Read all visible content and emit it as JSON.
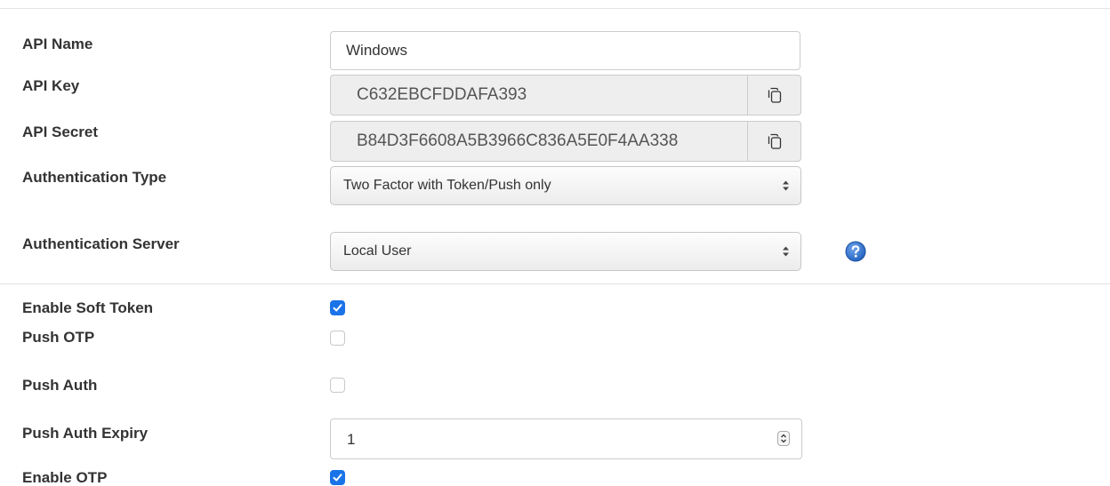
{
  "form": {
    "api_name": {
      "label": "API Name",
      "value": "Windows"
    },
    "api_key": {
      "label": "API Key",
      "value": "C632EBCFDDAFA393",
      "copy_icon": "copy-icon"
    },
    "api_secret": {
      "label": "API Secret",
      "value": "B84D3F6608A5B3966C836A5E0F4AA338",
      "copy_icon": "copy-icon"
    },
    "authentication_type": {
      "label": "Authentication Type",
      "selected": "Two Factor with Token/Push only"
    },
    "authentication_server": {
      "label": "Authentication Server",
      "selected": "Local User",
      "help_icon": "help-icon"
    },
    "enable_soft_token": {
      "label": "Enable Soft Token",
      "checked": true
    },
    "push_otp": {
      "label": "Push OTP",
      "checked": false
    },
    "push_auth": {
      "label": "Push Auth",
      "checked": false
    },
    "push_auth_expiry": {
      "label": "Push Auth Expiry",
      "value": "1"
    },
    "enable_otp": {
      "label": "Enable OTP",
      "checked": true
    }
  },
  "colors": {
    "checkbox_accent": "#1a73e8",
    "help_icon": "#1f5fbf",
    "readonly_bg": "#eeeeee",
    "label_text": "#333333"
  }
}
